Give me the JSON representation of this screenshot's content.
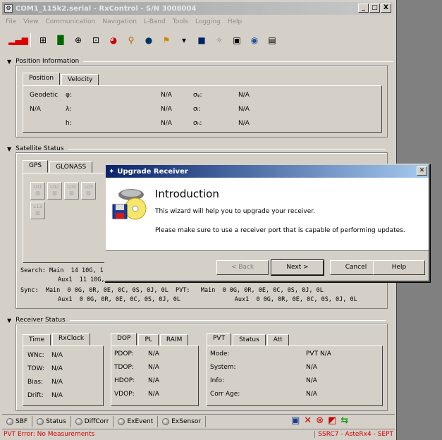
{
  "window": {
    "title": "COM1_115k2.serial - RxControl - S/N 3008004",
    "buttons": [
      "_",
      "□",
      "X"
    ]
  },
  "menu": [
    "File",
    "View",
    "Communication",
    "Navigation",
    "L-Band",
    "Tools",
    "Logging",
    "Help"
  ],
  "toolbar_icons": [
    "signal-bars-icon",
    "grid-icon",
    "bar-chart-icon",
    "target-icon",
    "plus-box-icon",
    "pie-chart-icon",
    "antenna-icon",
    "sphere-icon",
    "flag-icon",
    "dropdown-arrow-icon",
    "record-icon",
    "satellite-icon",
    "image-icon",
    "magnifier-icon",
    "document-icon"
  ],
  "position_info": {
    "header": "Position Information",
    "tabs": [
      "Position",
      "Velocity"
    ],
    "rows": [
      {
        "c1": "Geodetic",
        "sym": "φ:",
        "val": "N/A",
        "sig": "σᵩ:",
        "sval": "N/A"
      },
      {
        "c1": "N/A",
        "sym": "λ:",
        "val": "N/A",
        "sig": "σₗ:",
        "sval": "N/A"
      },
      {
        "c1": "",
        "sym": "h:",
        "val": "N/A",
        "sig": "σₕ:",
        "sval": "N/A"
      }
    ]
  },
  "satellite_status": {
    "header": "Satellite Status",
    "tabs": [
      "GPS",
      "GLONASS"
    ],
    "sats": [
      "L01",
      "L02",
      "L03",
      "L13"
    ],
    "search_main": "Search: Main  14 10G, 1",
    "search_aux": "Aux1  11 10G, 1",
    "sync_main": "Sync:  Main  0 0G, 0R, 0E, 0C, 0S, 0J, 0L  PVT:   Main  0 0G, 0R, 0E, 0C, 0S, 0J, 0L",
    "sync_aux": "Aux1  0 0G, 0R, 0E, 0C, 0S, 0J, 0L               Aux1  0 0G, 0R, 0E, 0C, 0S, 0J, 0L"
  },
  "receiver_status": {
    "header": "Receiver Status",
    "time_tabs": [
      "Time",
      "RxClock"
    ],
    "time_rows": [
      {
        "k": "WNc:",
        "v": "N/A"
      },
      {
        "k": "TOW:",
        "v": "N/A"
      },
      {
        "k": "Bias:",
        "v": "N/A"
      },
      {
        "k": "Drift:",
        "v": "N/A"
      }
    ],
    "dop_tabs": [
      "DOP",
      "PL",
      "RAIM"
    ],
    "dop_rows": [
      {
        "k": "PDOP:",
        "v": "N/A"
      },
      {
        "k": "TDOP:",
        "v": "N/A"
      },
      {
        "k": "HDOP:",
        "v": "N/A"
      },
      {
        "k": "VDOP:",
        "v": "N/A"
      }
    ],
    "pvt_tabs": [
      "PVT",
      "Status",
      "Att"
    ],
    "pvt_rows": [
      {
        "k": "Mode:",
        "v": "PVT N/A"
      },
      {
        "k": "System:",
        "v": "N/A"
      },
      {
        "k": "Info:",
        "v": "N/A"
      },
      {
        "k": "Corr Age:",
        "v": "N/A"
      }
    ]
  },
  "statusbar": {
    "buttons": [
      "SBF",
      "Status",
      "DiffCorr",
      "ExEvent",
      "ExSensor"
    ],
    "icons": [
      "save-icon",
      "cross-icon",
      "stop-circle-icon",
      "error-icon",
      "sync-arrows-icon"
    ]
  },
  "statusline": {
    "left": "PVT Error: No Measurements",
    "right": "SSRC7 - AsteRx4 - SEPT"
  },
  "dialog": {
    "title": "Upgrade Receiver",
    "heading": "Introduction",
    "line1": "This wizard will help you to upgrade your receiver.",
    "line2": "Please make sure to use a receiver port that is capable of performing updates.",
    "back": "< Back",
    "next": "Next >",
    "cancel": "Cancel",
    "help": "Help"
  }
}
